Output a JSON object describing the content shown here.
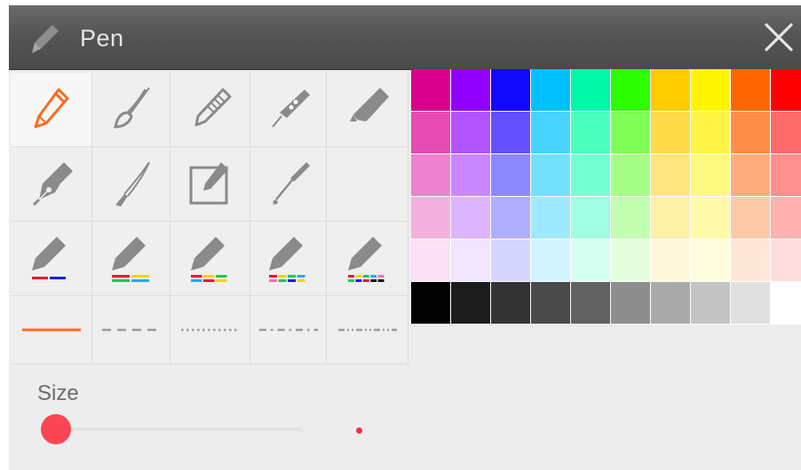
{
  "window": {
    "title": "Pen",
    "title_icon": "pen-icon",
    "close_icon": "close-icon"
  },
  "tools": {
    "rows": [
      [
        {
          "icon": "pencil-icon",
          "selected": true
        },
        {
          "icon": "paintbrush-icon"
        },
        {
          "icon": "crayon-icon"
        },
        {
          "icon": "fountain-pen-nib-icon"
        },
        {
          "icon": "highlighter-icon"
        }
      ],
      [
        {
          "icon": "calligraphy-pen-icon"
        },
        {
          "icon": "brush-pen-icon"
        },
        {
          "icon": "edit-box-icon"
        },
        {
          "icon": "dip-pen-icon"
        },
        {
          "icon": ""
        }
      ],
      [
        {
          "icon": "pencil-two-color-icon",
          "stripes": [
            "#e8192c",
            "#1a1aff"
          ]
        },
        {
          "icon": "pencil-rainbow-icon",
          "stripes": [
            "#e8192c",
            "#f5d20a",
            "#22c55e",
            "#2aa7f5"
          ]
        },
        {
          "icon": "pencil-rainbow-icon",
          "stripes": [
            "#e8192c",
            "#f5d20a",
            "#22c55e",
            "#2aa7f5",
            "#e8192c",
            "#f5d20a"
          ]
        },
        {
          "icon": "pencil-rainbow-icon",
          "stripes": [
            "#e8192c",
            "#f5d20a",
            "#22c55e",
            "#2aa7f5",
            "#ff69b4",
            "#22c55e",
            "#1a1aff",
            "#f5d20a"
          ]
        },
        {
          "icon": "pencil-rainbow-icon",
          "stripes": [
            "#e8192c",
            "#f5d20a",
            "#22c55e",
            "#2aa7f5",
            "#ff69b4",
            "#22c55e",
            "#1a1aff",
            "#e8192c",
            "#111111",
            "#111111"
          ]
        }
      ],
      [
        {
          "icon": "line-solid-icon",
          "style": "solid"
        },
        {
          "icon": "line-dashed-icon",
          "style": "dashed"
        },
        {
          "icon": "line-dotted-icon",
          "style": "dotted"
        },
        {
          "icon": "line-dash-dot-icon",
          "style": "dashdot"
        },
        {
          "icon": "line-dash-dot-dot-icon",
          "style": "dashdotdot"
        }
      ]
    ]
  },
  "palette": {
    "rows": [
      [
        "#d9008c",
        "#9000ff",
        "#1208ff",
        "#00c1ff",
        "#00f7a8",
        "#2cff00",
        "#ffcc00",
        "#fff500",
        "#ff6600",
        "#ff0000"
      ],
      [
        "#e64bb4",
        "#b355ff",
        "#6450ff",
        "#46d4ff",
        "#4affc0",
        "#80ff56",
        "#ffda49",
        "#fff547",
        "#ff8e4b",
        "#ff6b6b"
      ],
      [
        "#ef82ce",
        "#ca87ff",
        "#8e88ff",
        "#74e0ff",
        "#74ffd2",
        "#a6ff87",
        "#ffe57f",
        "#fff87f",
        "#ffad7f",
        "#ff8f8f"
      ],
      [
        "#f4b1df",
        "#ddb4ff",
        "#b0aeff",
        "#9fe9ff",
        "#9fffe0",
        "#c2ffb0",
        "#fff0a8",
        "#fffaaa",
        "#ffc9aa",
        "#ffb0b0"
      ],
      [
        "#fbe1f3",
        "#f1e5ff",
        "#d6d5ff",
        "#d1f4ff",
        "#d6fff2",
        "#e5ffde",
        "#fff8dc",
        "#fffddd",
        "#ffe6d9",
        "#ffdede"
      ],
      [
        "#000000",
        "#1c1c1c",
        "#333333",
        "#4a4a4a",
        "#626262",
        "#8e8e8e",
        "#aaaaaa",
        "#c4c4c4",
        "#e0e0e0",
        "#ffffff"
      ]
    ]
  },
  "size": {
    "label": "Size",
    "value_fraction": 0.0,
    "thumb_color": "#fb4554",
    "preview_color": "#ff2a3d"
  },
  "colors": {
    "accent": "#ff6a1f",
    "icon_gray": "#8a8a8a"
  }
}
